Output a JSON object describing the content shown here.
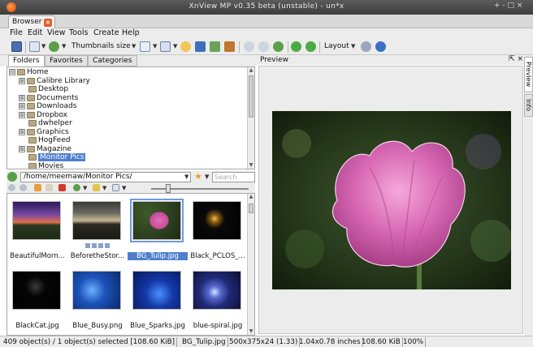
{
  "window": {
    "title": "XnView MP v0.35 beta (unstable) - un*x",
    "controls": "+ - □ ×"
  },
  "tabs": {
    "browser_label": "Browser",
    "close_glyph": "×"
  },
  "menu": [
    "File",
    "Edit",
    "View",
    "Tools",
    "Create",
    "Help"
  ],
  "toolbar": {
    "thumbnails_size_label": "Thumbnails size",
    "layout_label": "Layout",
    "drop_glyph": "▼"
  },
  "panel_tabs": [
    "Folders",
    "Favorites",
    "Categories"
  ],
  "tree": [
    {
      "label": "Home",
      "expander": "⊟"
    },
    {
      "label": "Calibre Library",
      "expander": "⊞"
    },
    {
      "label": "Desktop",
      "expander": ""
    },
    {
      "label": "Documents",
      "expander": "⊞"
    },
    {
      "label": "Downloads",
      "expander": "⊞"
    },
    {
      "label": "Dropbox",
      "expander": "⊞"
    },
    {
      "label": "dwhelper",
      "expander": ""
    },
    {
      "label": "Graphics",
      "expander": "⊞"
    },
    {
      "label": "HogFeed",
      "expander": ""
    },
    {
      "label": "Magazine",
      "expander": "⊞"
    },
    {
      "label": "Monitor Pics",
      "expander": "",
      "selected": true
    },
    {
      "label": "Movies",
      "expander": ""
    }
  ],
  "path": {
    "value": "/home/meemaw/Monitor Pics/",
    "search_placeholder": "Search"
  },
  "thumbnails": [
    {
      "caption": "BeautifulMorn...",
      "icon": "sunset-image"
    },
    {
      "caption": "BeforetheStor...",
      "icon": "storm-image"
    },
    {
      "caption": "BG_Tulip.jpg",
      "icon": "tulip-image",
      "selected": true
    },
    {
      "caption": "Black_PCLOS_...",
      "icon": "sparkle-image"
    },
    {
      "caption": "BlackCat.jpg",
      "icon": "black-cat-image"
    },
    {
      "caption": "Blue_Busy.png",
      "icon": "blue-pattern-image"
    },
    {
      "caption": "Blue_Sparks.jpg",
      "icon": "blue-sparks-image"
    },
    {
      "caption": "blue-spiral.jpg",
      "icon": "blue-spiral-image"
    }
  ],
  "preview": {
    "title": "Preview",
    "controls": "⇱ ×",
    "side_tabs": [
      "Preview",
      "Info"
    ]
  },
  "status": [
    "409 object(s) / 1 object(s) selected [108.60 KiB]",
    "BG_Tulip.jpg",
    "500x375x24 (1.33)",
    "1.04x0.78 inches",
    "108.60 KiB",
    "100%"
  ]
}
